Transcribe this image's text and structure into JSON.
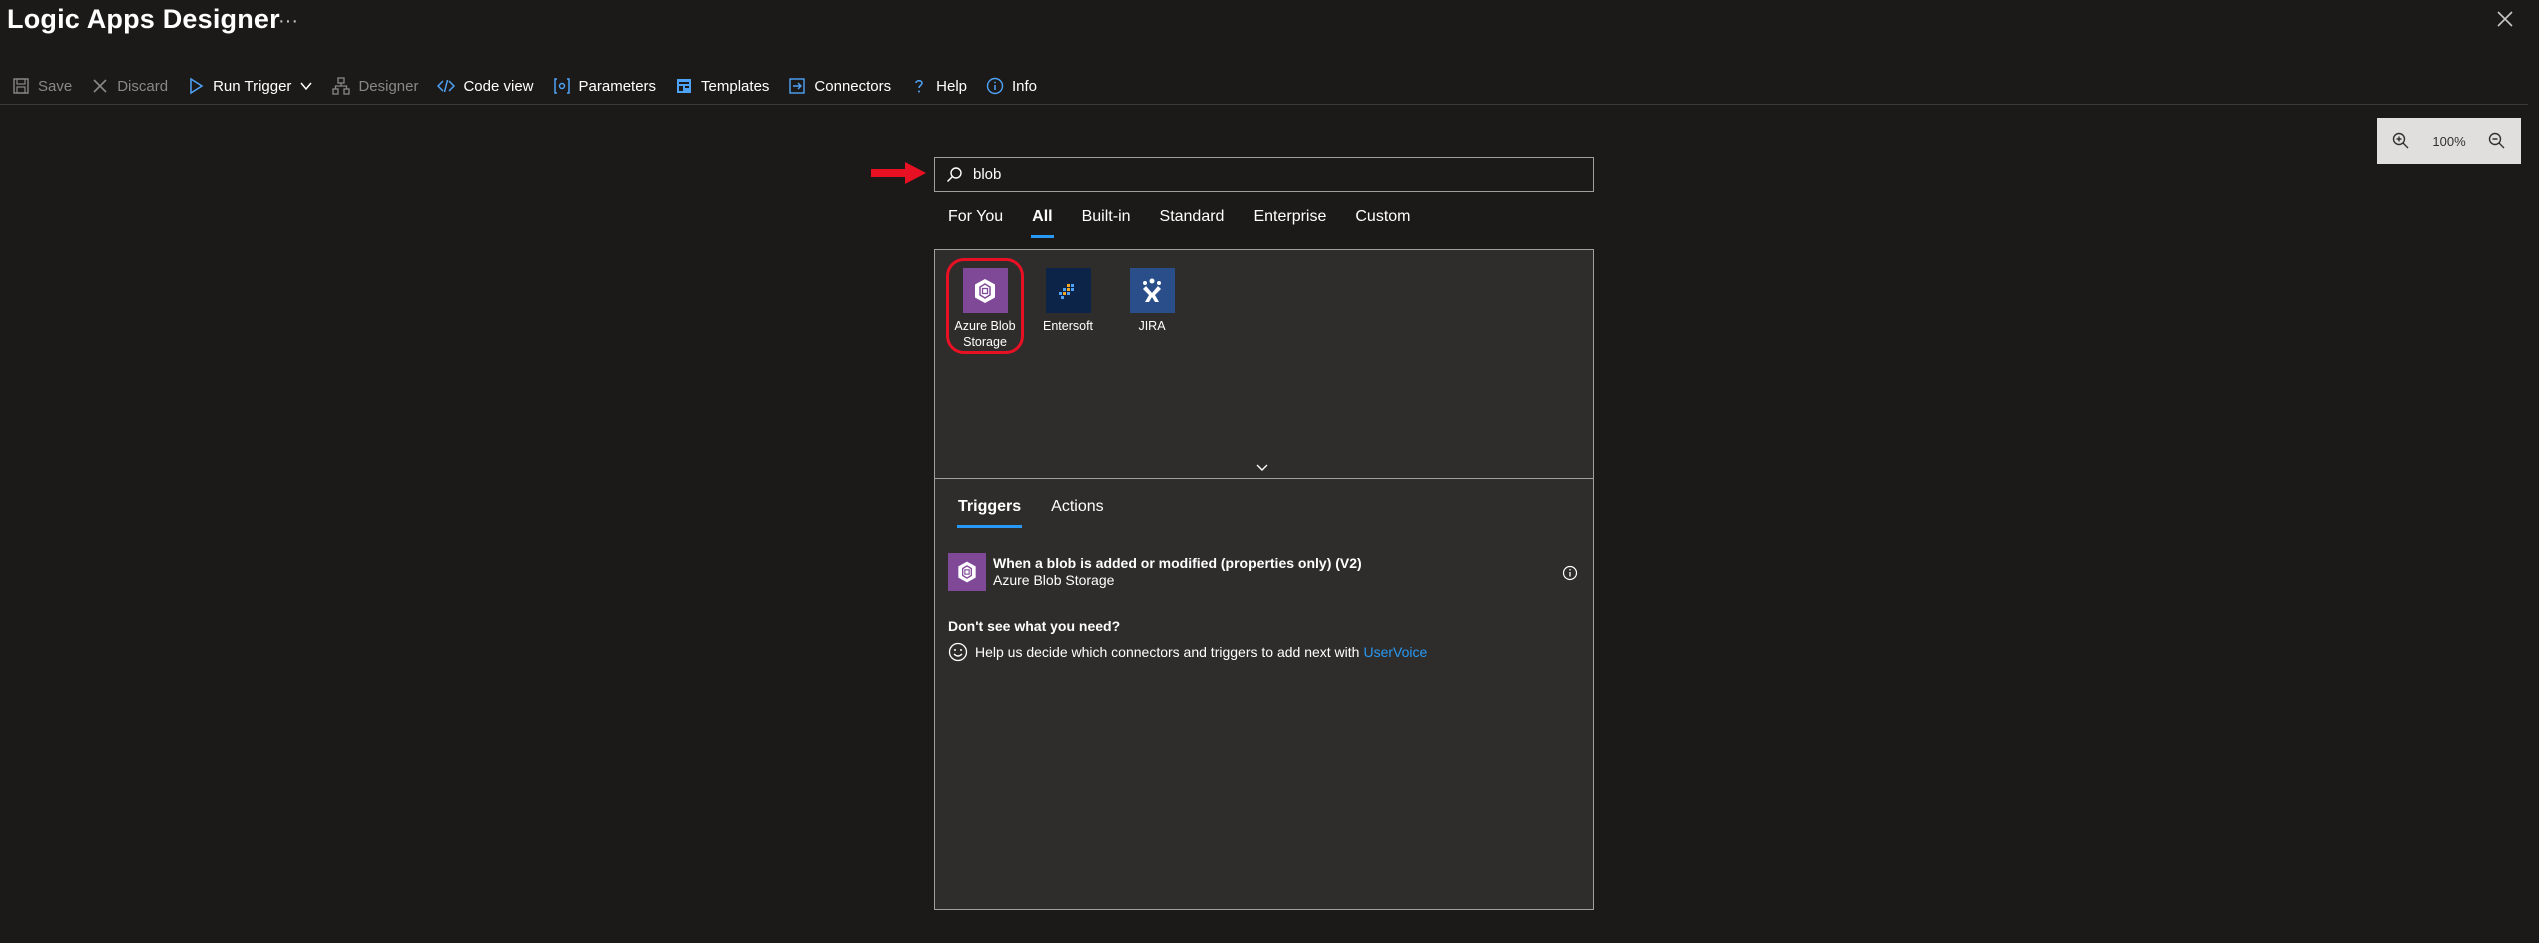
{
  "header": {
    "title": "Logic Apps Designer",
    "more": "···"
  },
  "toolbar": {
    "save": "Save",
    "discard": "Discard",
    "run_trigger": "Run Trigger",
    "designer": "Designer",
    "code_view": "Code view",
    "parameters": "Parameters",
    "templates": "Templates",
    "connectors": "Connectors",
    "help": "Help",
    "info": "Info"
  },
  "zoom": {
    "level": "100%"
  },
  "search": {
    "value": "blob"
  },
  "tabs": [
    {
      "label": "For You"
    },
    {
      "label": "All",
      "active": true
    },
    {
      "label": "Built-in"
    },
    {
      "label": "Standard"
    },
    {
      "label": "Enterprise"
    },
    {
      "label": "Custom"
    }
  ],
  "connectors": [
    {
      "label": "Azure Blob Storage",
      "icon": "azure-blob-storage-icon",
      "color": "#804998"
    },
    {
      "label": "Entersoft",
      "icon": "entersoft-icon",
      "color": "#0b2447"
    },
    {
      "label": "JIRA",
      "icon": "jira-icon",
      "color": "#2a4e8a"
    }
  ],
  "subtabs": {
    "triggers": "Triggers",
    "actions": "Actions"
  },
  "operations": [
    {
      "title": "When a blob is added or modified (properties only) (V2)",
      "connector": "Azure Blob Storage"
    }
  ],
  "help": {
    "heading": "Don't see what you need?",
    "text": "Help us decide which connectors and triggers to add next with",
    "link": "UserVoice"
  },
  "colors": {
    "accent": "#2899f5",
    "highlight": "#e81123",
    "blob": "#804998"
  }
}
